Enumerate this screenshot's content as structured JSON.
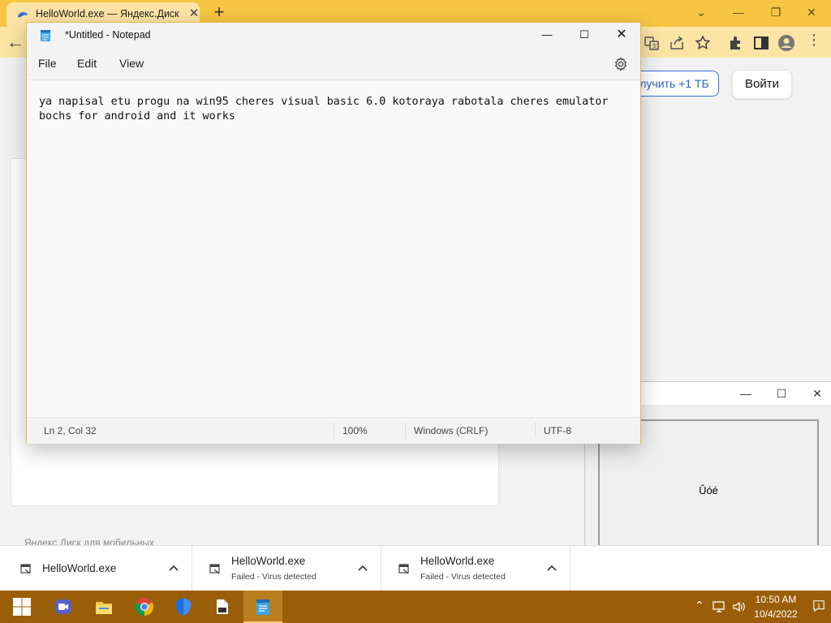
{
  "browser": {
    "tab_title": "HelloWorld.exe — Яндекс.Диск",
    "get_tb_label": "лучить +1 ТБ",
    "login_label": "Войти",
    "footer_text": "Яндекс.Диск для мобильных"
  },
  "notepad": {
    "title": "*Untitled - Notepad",
    "menu": [
      "File",
      "Edit",
      "View"
    ],
    "content": "ya napisal etu progu na win95 cheres visual basic 6.0 kotoraya rabotala cheres emulator\nbochs for android and it works",
    "status": {
      "position": "Ln 2, Col 32",
      "zoom": "100%",
      "line_ending": "Windows (CRLF)",
      "encoding": "UTF-8"
    }
  },
  "app_window": {
    "label": "Ûóé"
  },
  "downloads": [
    {
      "name": "HelloWorld.exe",
      "status": ""
    },
    {
      "name": "HelloWorld.exe",
      "status": "Failed - Virus detected"
    },
    {
      "name": "HelloWorld.exe",
      "status": "Failed - Virus detected"
    }
  ],
  "taskbar": {
    "apps": [
      "start-icon",
      "meet-icon",
      "file-explorer-icon",
      "chrome-icon",
      "defender-icon",
      "explorer-file-icon",
      "notepad-icon"
    ],
    "time": "10:50 AM",
    "date": "10/4/2022"
  },
  "colors": {
    "tab_strip": "#f5c543",
    "taskbar": "#9a5e08",
    "accent_blue": "#2a62c9"
  }
}
